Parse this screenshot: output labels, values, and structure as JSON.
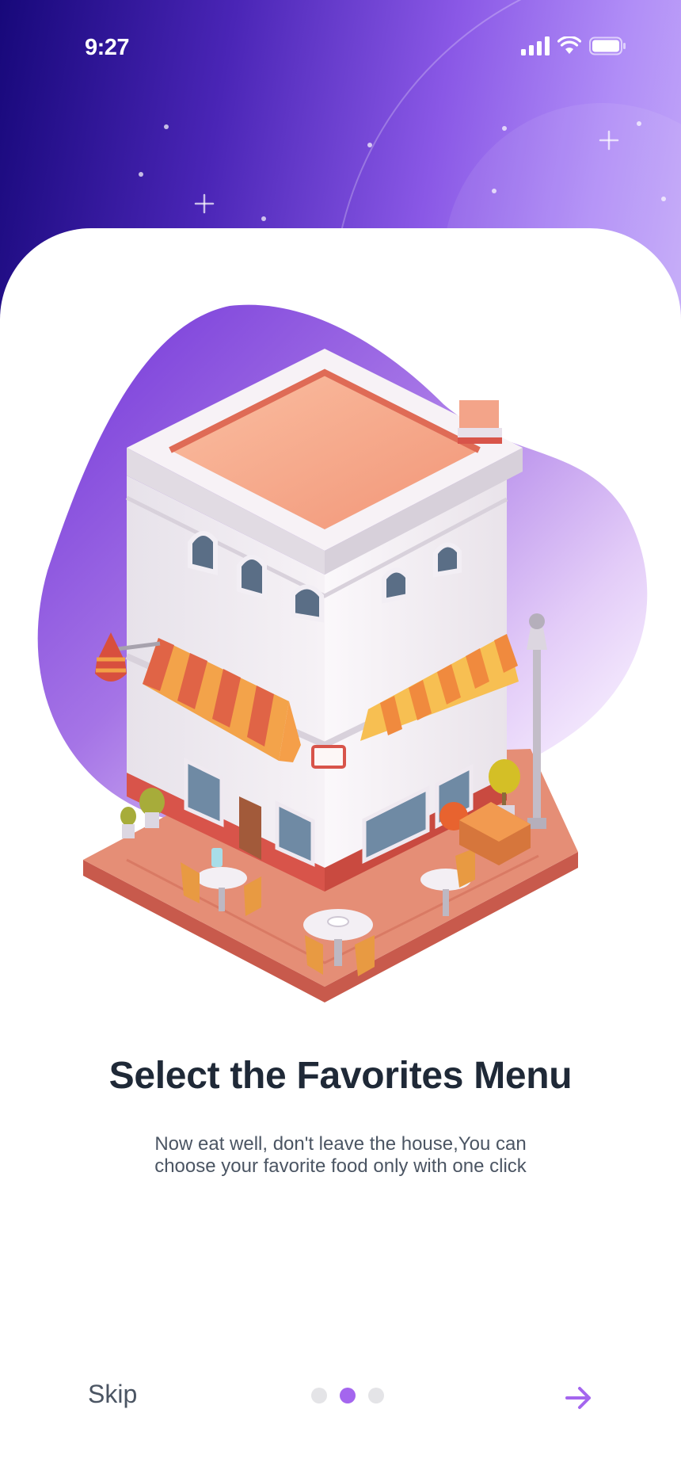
{
  "status_bar": {
    "time": "9:27",
    "icons": [
      "signal-icon",
      "wifi-icon",
      "battery-icon"
    ]
  },
  "onboarding": {
    "title": "Select the Favorites Menu",
    "subtitle": "Now eat well, don't leave the house,You can choose your favorite food only with one click",
    "illustration": "restaurant-building-illustration"
  },
  "footer": {
    "skip_label": "Skip",
    "page_count": 3,
    "active_page": 2,
    "next_icon": "arrow-right-icon"
  },
  "colors": {
    "header_gradient_start": "#17087a",
    "header_gradient_end": "#c3a9f8",
    "accent": "#a466ee",
    "title": "#1f2937",
    "body_text": "#4b5563",
    "inactive_dot": "#e4e4e7"
  }
}
